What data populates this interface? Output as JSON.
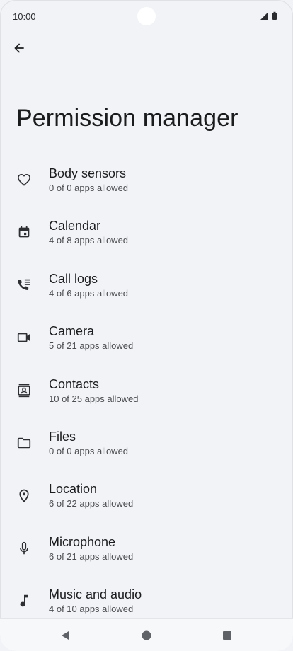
{
  "status_bar": {
    "time": "10:00"
  },
  "header": {
    "back_icon": "arrow-back-icon",
    "title": "Permission manager"
  },
  "permissions": [
    {
      "icon": "heart-icon",
      "title": "Body sensors",
      "summary": "0 of 0 apps allowed"
    },
    {
      "icon": "calendar-icon",
      "title": "Calendar",
      "summary": "4 of 8 apps allowed"
    },
    {
      "icon": "call-log-icon",
      "title": "Call logs",
      "summary": "4 of 6 apps allowed"
    },
    {
      "icon": "camera-icon",
      "title": "Camera",
      "summary": "5 of 21 apps allowed"
    },
    {
      "icon": "contacts-icon",
      "title": "Contacts",
      "summary": "10 of 25 apps allowed"
    },
    {
      "icon": "folder-icon",
      "title": "Files",
      "summary": "0 of 0 apps allowed"
    },
    {
      "icon": "location-pin-icon",
      "title": "Location",
      "summary": "6 of 22 apps allowed"
    },
    {
      "icon": "microphone-icon",
      "title": "Microphone",
      "summary": "6 of 21 apps allowed"
    },
    {
      "icon": "music-note-icon",
      "title": "Music and audio",
      "summary": "4 of 10 apps allowed"
    }
  ],
  "nav_bar": {
    "back_icon": "nav-back-triangle-icon",
    "home_icon": "nav-home-circle-icon",
    "recents_icon": "nav-recents-square-icon"
  },
  "colors": {
    "background": "#f1f3f6",
    "text_primary": "#1b1c1e",
    "text_secondary": "#4a4c50",
    "icon": "#2d2f33",
    "nav_icon": "#5f6266"
  }
}
